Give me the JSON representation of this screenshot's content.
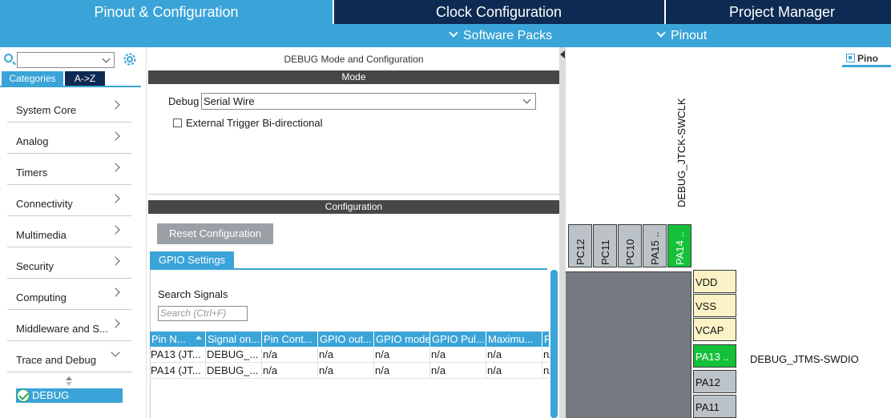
{
  "top_tabs": {
    "pinout_config": "Pinout & Configuration",
    "clock_config": "Clock Configuration",
    "project_manager": "Project Manager"
  },
  "sub_menu": {
    "software_packs": "Software Packs",
    "pinout": "Pinout"
  },
  "left": {
    "search_value": "",
    "tab_categories": "Categories",
    "tab_az": "A->Z",
    "categories": [
      {
        "label": "System Core",
        "state": "collapsed"
      },
      {
        "label": "Analog",
        "state": "collapsed"
      },
      {
        "label": "Timers",
        "state": "collapsed"
      },
      {
        "label": "Connectivity",
        "state": "collapsed"
      },
      {
        "label": "Multimedia",
        "state": "collapsed"
      },
      {
        "label": "Security",
        "state": "collapsed"
      },
      {
        "label": "Computing",
        "state": "collapsed"
      },
      {
        "label": "Middleware and S...",
        "state": "collapsed"
      },
      {
        "label": "Trace and Debug",
        "state": "expanded"
      }
    ],
    "selected_item": "DEBUG"
  },
  "mid": {
    "title": "DEBUG Mode and Configuration",
    "mode_bar": "Mode",
    "debug_label": "Debug",
    "debug_value": "Serial Wire",
    "ext_trigger_label": "External Trigger Bi-directional",
    "ext_trigger_checked": false,
    "config_bar": "Configuration",
    "reset_button": "Reset Configuration",
    "gpio_tab": "GPIO Settings",
    "search_signals_label": "Search Signals",
    "search_placeholder": "Search (Ctrl+F)",
    "columns": [
      "Pin N...",
      "Signal on...",
      "Pin Cont...",
      "GPIO out...",
      "GPIO mode",
      "GPIO Pul...",
      "Maximu...",
      "F"
    ],
    "rows": [
      [
        "PA13 (JT...",
        "DEBUG_...",
        "n/a",
        "n/a",
        "n/a",
        "n/a",
        "n/a",
        "n/"
      ],
      [
        "PA14 (JT...",
        "DEBUG_...",
        "n/a",
        "n/a",
        "n/a",
        "n/a",
        "n/a",
        "n/"
      ]
    ]
  },
  "right": {
    "pinout_tab": "Pino",
    "swclk_label": "DEBUG_JTCK-SWCLK",
    "swdio_label": "DEBUG_JTMS-SWDIO",
    "top_pins": [
      {
        "name": "PC12",
        "state": "default"
      },
      {
        "name": "PC11",
        "state": "default"
      },
      {
        "name": "PC10",
        "state": "default"
      },
      {
        "name": "PA15 ..",
        "state": "default"
      },
      {
        "name": "PA14 ..",
        "state": "assigned"
      }
    ],
    "side_pins": [
      {
        "name": "VDD",
        "type": "power"
      },
      {
        "name": "VSS",
        "type": "power"
      },
      {
        "name": "VCAP",
        "type": "power"
      },
      {
        "name": "PA13 ..",
        "type": "assigned"
      },
      {
        "name": "PA12",
        "type": "gpio"
      },
      {
        "name": "PA11",
        "type": "gpio"
      }
    ]
  },
  "colors": {
    "accent": "#3aa4d8",
    "dark_navy": "#0d2b52",
    "assigned_pin": "#15c13a",
    "power_pin": "#fbf2c6",
    "default_pin": "#bcc3c8"
  }
}
